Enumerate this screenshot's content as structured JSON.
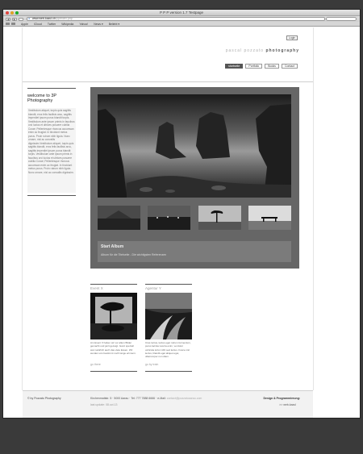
{
  "window": {
    "title": "P P P version 1.7 Testpage"
  },
  "toolbar": {
    "back": "◀",
    "forward": "▶",
    "url_host": "www.web-kazul.ch",
    "url_path": "/pp/index.php",
    "url_icon": "globe-icon"
  },
  "bookmarks": [
    "Apple",
    "iCloud",
    "Twitter",
    "Wikipedia",
    "Yahoo!",
    "News ▾",
    "Beliebt ▾"
  ],
  "header": {
    "login": "Login",
    "brand_light": "pascal pozzato",
    "brand_dark": "photography",
    "nav": [
      "startseite",
      "Portfolio",
      "Books",
      "Contact"
    ]
  },
  "sidebar": {
    "title": "welcome to 3P Photography",
    "text": "Vestibulum aliquet, turpis quis sagittis blandit, eros felis facilisis arcu, sagittis imperdiet ipsum purus blandit turpis. Vestibulum ante ipsum primis in faucibus orci luctus et ultrices posuere cubilia Curae; Pellentesque rhoncus accumsan enim ac feugiat. In tincidunt metus purus. Proin rutrum nibh ligula. Nunc ornare, nisl ac convallis dignissim.Vestibulum aliquet, turpis quis sagittis blandit, eros felis facilisis arcu, sagittis imperdiet ipsum purus blandit turpis. Vestibulum ante ipsum primis in faucibus orci luctus et ultrices posuere cubilia Curae; Pellentesque rhoncus accumsan enim ac feugiat. In tincidunt metus purus. Proin rutrum nibh ligula. Nunc ornare, nisl ac convallis dignissim."
  },
  "album": {
    "title": "Start Album",
    "description": "Album für die Titelseite - Die wichtigsten Referenzen"
  },
  "events": [
    {
      "title": "Event X",
      "text": "Am Event X haben wir vor allem Bilder gemacht und jetzt gezeigt. Ganz speziell war natürlich auch das viele Essen. Wir werden uns bestimmt noch lange erinnern.",
      "more": "go there"
    },
    {
      "title": "Agentur Y",
      "text": "Cras luctus, lectus eget rutrum fermentum, purus lacinia viverra enim, vel dolor vehicula tortor nibh sed lectus. Fusce nisl lectus, blandit eget aliquet eget, ullamcorper non diam.",
      "more": "go by train"
    }
  ],
  "footer": {
    "copyright": "© by Pozzato Photography",
    "address": "Kirchenmattstr. 5 · 5000 Aarau · Tel: 777 7888 6666 · e-Mail: ",
    "email": "contact@pozzatoaarau.com",
    "last_visit": "last update: 08.oct.13",
    "design_label": "Design & Programmierung:",
    "design_link": ">> web-kazul"
  }
}
